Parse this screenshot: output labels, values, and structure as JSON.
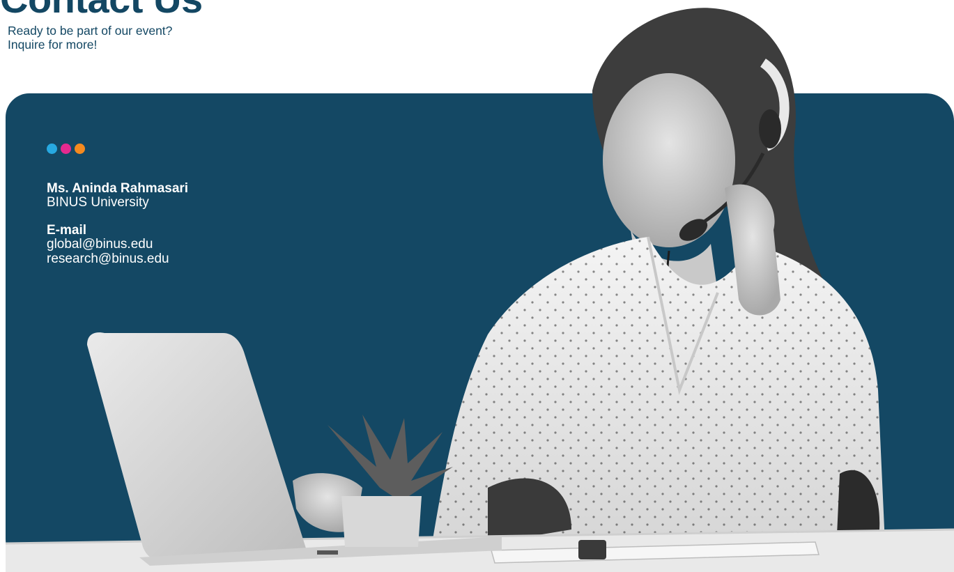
{
  "header": {
    "title": "Contact Us",
    "subtitle_line1": "Ready to be part of our event?",
    "subtitle_line2": "Inquire for more!"
  },
  "decor": {
    "dots": [
      {
        "name": "blue-dot",
        "color": "#27A9E1"
      },
      {
        "name": "pink-dot",
        "color": "#E42A8F"
      },
      {
        "name": "orange-dot",
        "color": "#F58A1F"
      }
    ],
    "panel_color": "#144864",
    "illustration": "person-with-headset-at-laptop-photo"
  },
  "contact": {
    "name": "Ms. Aninda Rahmasari",
    "organization": "BINUS University",
    "email_label": "E-mail",
    "emails": [
      "global@binus.edu",
      "research@binus.edu"
    ]
  }
}
